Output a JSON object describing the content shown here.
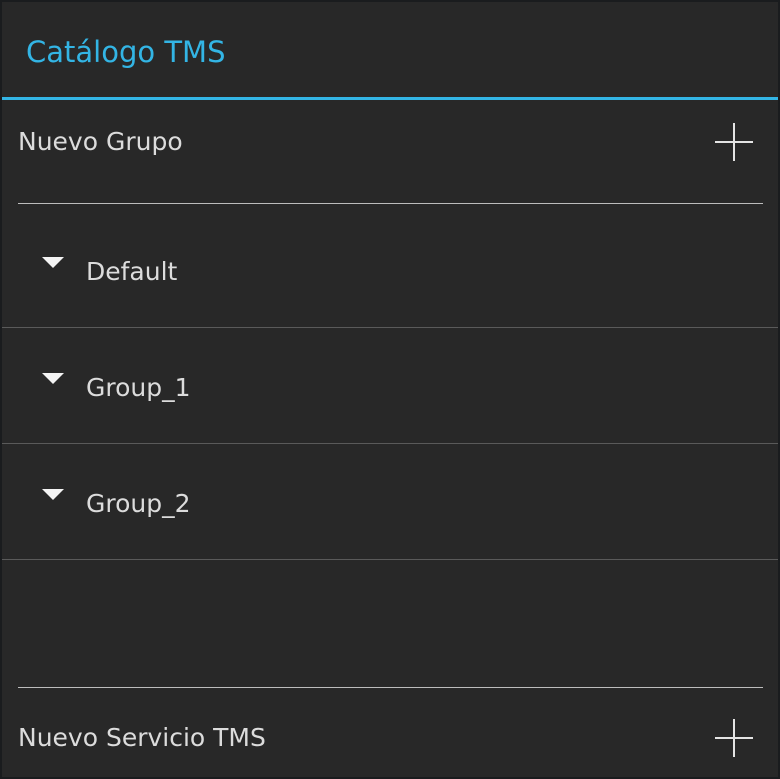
{
  "dialog": {
    "title": "Catálogo TMS",
    "accent_color": "#33b5e5",
    "background_color": "#282828"
  },
  "new_group": {
    "label": "Nuevo Grupo",
    "icon": "plus-icon"
  },
  "groups": [
    {
      "label": "Default",
      "icon": "caret-down-icon"
    },
    {
      "label": "Group_1",
      "icon": "caret-down-icon"
    },
    {
      "label": "Group_2",
      "icon": "caret-down-icon"
    }
  ],
  "new_service": {
    "label": "Nuevo Servicio TMS",
    "icon": "plus-icon"
  }
}
